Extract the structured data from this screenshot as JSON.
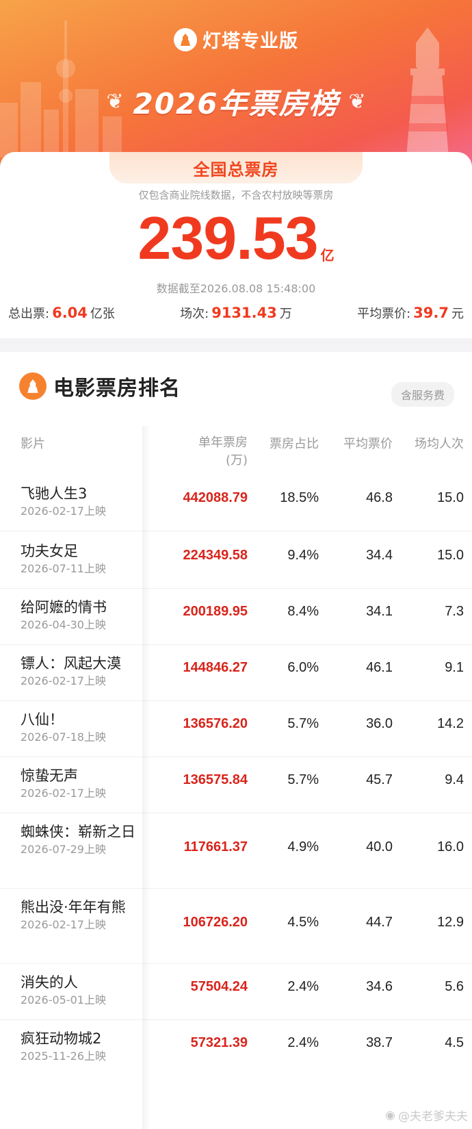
{
  "app": {
    "brand": "灯塔专业版",
    "board_title": "2026年票房榜"
  },
  "summary": {
    "tab": "全国总票房",
    "note": "仅包含商业院线数据，不含农村放映等票房",
    "total": "239.53",
    "total_unit": "亿",
    "as_of": "数据截至2026.08.08 15:48:00",
    "stats": [
      {
        "label": "总出票:",
        "value": "6.04",
        "unit": "亿张"
      },
      {
        "label": "场次:",
        "value": "9131.43",
        "unit": "万"
      },
      {
        "label": "平均票价:",
        "value": "39.7",
        "unit": "元"
      }
    ]
  },
  "ranking": {
    "title": "电影票房排名",
    "fee_badge": "含服务费",
    "columns": {
      "film": "影片",
      "gross_line1": "单年票房",
      "gross_line2": "(万)",
      "share": "票房占比",
      "price": "平均票价",
      "audience": "场均人次"
    },
    "rows": [
      {
        "name": "飞驰人生3",
        "date": "2026-02-17上映",
        "gross": "442088.79",
        "share": "18.5%",
        "price": "46.8",
        "audience": "15.0"
      },
      {
        "name": "功夫女足",
        "date": "2026-07-11上映",
        "gross": "224349.58",
        "share": "9.4%",
        "price": "34.4",
        "audience": "15.0"
      },
      {
        "name": "给阿嬷的情书",
        "date": "2026-04-30上映",
        "gross": "200189.95",
        "share": "8.4%",
        "price": "34.1",
        "audience": "7.3"
      },
      {
        "name": "镖人：风起大漠",
        "date": "2026-02-17上映",
        "gross": "144846.27",
        "share": "6.0%",
        "price": "46.1",
        "audience": "9.1"
      },
      {
        "name": "八仙！",
        "date": "2026-07-18上映",
        "gross": "136576.20",
        "share": "5.7%",
        "price": "36.0",
        "audience": "14.2"
      },
      {
        "name": "惊蛰无声",
        "date": "2026-02-17上映",
        "gross": "136575.84",
        "share": "5.7%",
        "price": "45.7",
        "audience": "9.4"
      },
      {
        "name": "蜘蛛侠：崭新之日",
        "date": "2026-07-29上映",
        "gross": "117661.37",
        "share": "4.9%",
        "price": "40.0",
        "audience": "16.0"
      },
      {
        "name": "熊出没·年年有熊",
        "date": "2026-02-17上映",
        "gross": "106726.20",
        "share": "4.5%",
        "price": "44.7",
        "audience": "12.9"
      },
      {
        "name": "消失的人",
        "date": "2026-05-01上映",
        "gross": "57504.24",
        "share": "2.4%",
        "price": "34.6",
        "audience": "5.6"
      },
      {
        "name": "疯狂动物城2",
        "date": "2025-11-26上映",
        "gross": "57321.39",
        "share": "2.4%",
        "price": "38.7",
        "audience": "4.5"
      }
    ]
  },
  "watermark": "@夫老爹夫夫",
  "colors": {
    "accent": "#f03a20",
    "gross": "#d9241b",
    "banner_start": "#f7a34a",
    "banner_end": "#f56fa0"
  }
}
